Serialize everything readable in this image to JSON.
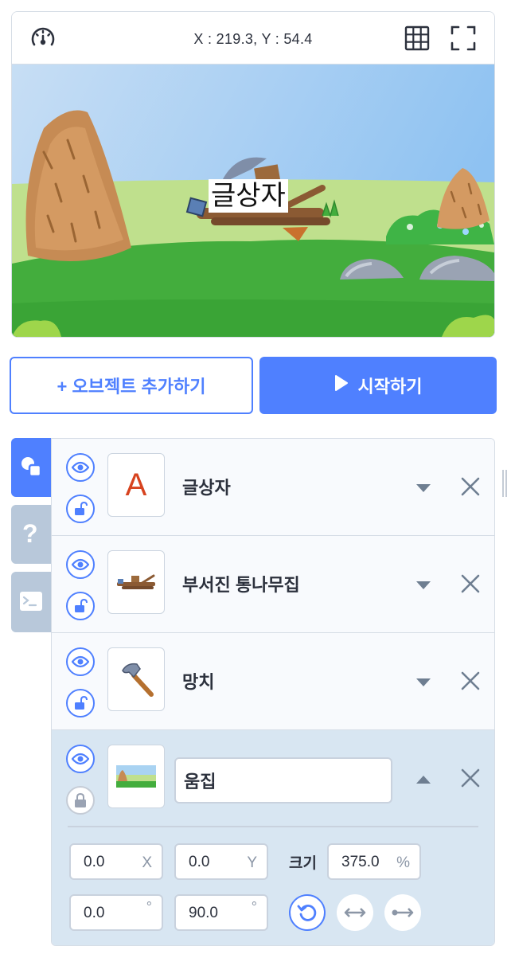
{
  "stage": {
    "coords": "X : 219.3, Y : 54.4",
    "speed_icon": "speedometer-icon",
    "grid_icon": "grid-icon",
    "fullscreen_icon": "fullscreen-icon",
    "text_object": "글상자"
  },
  "actions": {
    "add_object_label": "+ 오브젝트 추가하기",
    "start_label": "시작하기"
  },
  "side_tabs": [
    {
      "name": "objects",
      "icon": "shapes-icon",
      "active": true
    },
    {
      "name": "help",
      "icon": "question-icon",
      "active": false
    },
    {
      "name": "console",
      "icon": "console-icon",
      "active": false
    }
  ],
  "objects": [
    {
      "name": "글상자",
      "thumb_letter": "A",
      "visible": true,
      "locked": false
    },
    {
      "name": "부서진 통나무집",
      "visible": true,
      "locked": false
    },
    {
      "name": "망치",
      "visible": true,
      "locked": false
    },
    {
      "name": "움집",
      "visible": true,
      "locked": true,
      "selected": true
    }
  ],
  "selected_object": {
    "name": "움집",
    "x": "0.0",
    "x_unit": "X",
    "y": "0.0",
    "y_unit": "Y",
    "size_label": "크기",
    "size": "375.0",
    "size_unit": "%",
    "rotation": "0.0",
    "direction": "90.0",
    "degree_symbol": "°"
  },
  "colors": {
    "accent": "#4f80ff",
    "tab_inactive": "#b8c8da",
    "selected_row": "#d8e6f2",
    "delete_x": "#6e7e91"
  }
}
